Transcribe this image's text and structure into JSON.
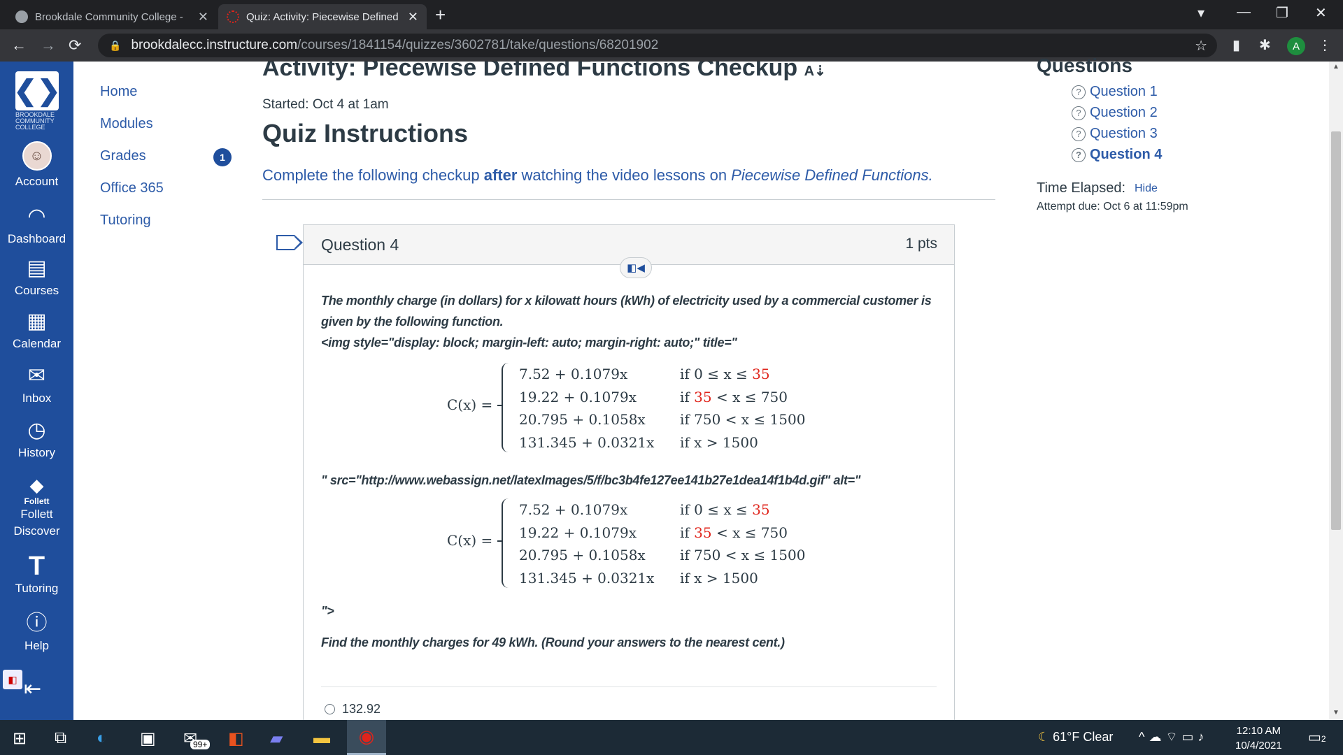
{
  "browser": {
    "tabs": [
      {
        "title": "Brookdale Community College - ",
        "active": false
      },
      {
        "title": "Quiz: Activity: Piecewise Defined",
        "active": true
      }
    ],
    "url_host": "brookdalecc.instructure.com",
    "url_path": "/courses/1841154/quizzes/3602781/take/questions/68201902",
    "profile_initial": "A"
  },
  "global_nav": {
    "logo_text": "BROOKDALE COMMUNITY COLLEGE",
    "items": [
      {
        "label": "Account"
      },
      {
        "label": "Dashboard"
      },
      {
        "label": "Courses"
      },
      {
        "label": "Calendar"
      },
      {
        "label": "Inbox"
      },
      {
        "label": "History"
      },
      {
        "label": "Follett",
        "sub": "Follett"
      },
      {
        "label": "Discover"
      },
      {
        "label": "Tutoring"
      },
      {
        "label": "Help"
      }
    ]
  },
  "course_nav": {
    "items": [
      {
        "label": "Home"
      },
      {
        "label": "Modules"
      },
      {
        "label": "Grades",
        "badge": "1"
      },
      {
        "label": "Office 365"
      },
      {
        "label": "Tutoring"
      }
    ]
  },
  "quiz": {
    "title": "Activity: Piecewise Defined Functions Checkup",
    "started": "Started: Oct 4 at 1am",
    "instructions_title": "Quiz Instructions",
    "instructions_pre": "Complete the following checkup ",
    "instructions_bold": "after",
    "instructions_mid": " watching the video lessons on ",
    "instructions_italic": "Piecewise Defined Functions.",
    "question": {
      "name": "Question 4",
      "points": "1 pts",
      "text1": "The monthly charge (in dollars) for x kilowatt hours (kWh) of electricity used by a commercial customer is given by the following function.",
      "text2": "<img style=\"display: block; margin-left: auto; margin-right: auto;\" title=\"",
      "text3": "\" src=\"http://www.webassign.net/latexImages/5/f/bc3b4fe127ee141b27e1dea14f1b4d.gif\" alt=\"",
      "text4": "\">",
      "text5": "Find the monthly charges for 49 kWh. (Round your answers to the nearest cent.)",
      "function_lhs": "C(x) =",
      "pieces": [
        {
          "expr": "7.52 + 0.1079x",
          "cond_pre": "if 0 ≤ x ≤ ",
          "cond_red": "35",
          "cond_post": ""
        },
        {
          "expr": "19.22 + 0.1079x",
          "cond_pre": "if ",
          "cond_red": "35",
          "cond_post": " < x ≤ 750"
        },
        {
          "expr": "20.795 + 0.1058x",
          "cond_pre": "if 750 < x ≤ 1500",
          "cond_red": "",
          "cond_post": ""
        },
        {
          "expr": "131.345 + 0.0321x",
          "cond_pre": "if x > 1500",
          "cond_red": "",
          "cond_post": ""
        }
      ],
      "choice": "132.92"
    }
  },
  "sidebar": {
    "title": "Questions",
    "questions": [
      "Question 1",
      "Question 2",
      "Question 3",
      "Question 4"
    ],
    "time_label": "Time Elapsed:",
    "hide": "Hide",
    "due": "Attempt due: Oct 6 at 11:59pm"
  },
  "taskbar": {
    "badge": "99+",
    "weather": "61°F  Clear",
    "time": "12:10 AM",
    "date": "10/4/2021",
    "notifications": "2"
  }
}
